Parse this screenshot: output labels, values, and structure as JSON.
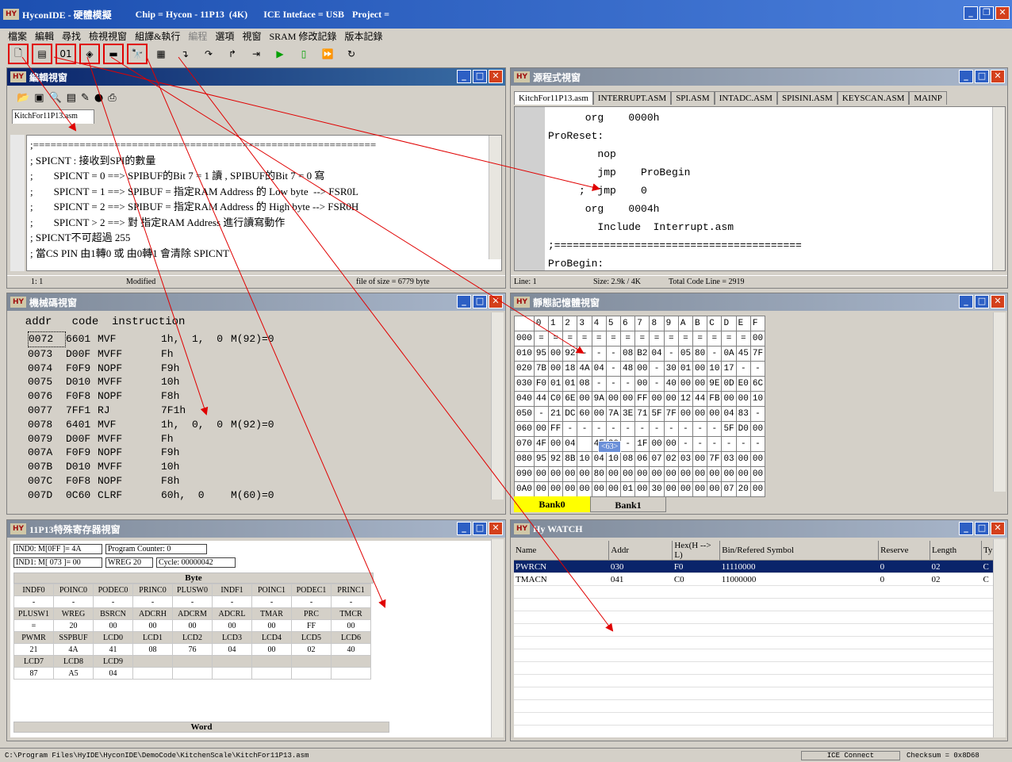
{
  "app": {
    "title": "HyconIDE - 硬體模擬",
    "chip": "Chip = Hycon - 11P13  (4K)",
    "ice": "ICE Inteface = USB",
    "project": "Project ="
  },
  "menu": [
    "檔案",
    "編輯",
    "尋找",
    "檢視視窗",
    "組譯&執行",
    "編程",
    "選項",
    "視窗",
    "SRAM 修改記錄",
    "版本記錄"
  ],
  "toolbar": [
    "new-file-icon",
    "open-file-icon",
    "binary-icon",
    "chip-icon",
    "link-icon",
    "find-icon",
    "memory-icon",
    "step-into-icon",
    "step-over-icon",
    "step-out-icon",
    "run-to-cursor-icon",
    "run-icon",
    "stop-icon",
    "fast-run-icon",
    "reset-icon"
  ],
  "editor": {
    "title": "編輯視窗",
    "tab": "KitchFor11P13.asm",
    "lines": [
      ";===========================================================",
      "; SPICNT : 接收到SPI的數量",
      ";        SPICNT = 0 ==> SPIBUF的Bit 7 = 1 讀 , SPIBUF的Bit 7 = 0 寫",
      ";        SPICNT = 1 ==> SPIBUF = 指定RAM Address 的 Low byte  --> FSR0L",
      ";        SPICNT = 2 ==> SPIBUF = 指定RAM Address 的 High byte --> FSR0H",
      ";        SPICNT > 2 ==> 對 指定RAM Address 進行讀寫動作",
      "; SPICNT不可超過 255",
      "; 當CS PIN 由1轉0 或 由0轉1 會清除 SPICNT"
    ],
    "status_pos": "1: 1",
    "status_mod": "Modified",
    "status_size": "file of size = 6779 byte"
  },
  "source": {
    "title": "源程式視窗",
    "tabs": [
      "KitchFor11P13.asm",
      "INTERRUPT.ASM",
      "SPI.ASM",
      "INTADC.ASM",
      "SPISINI.ASM",
      "KEYSCAN.ASM",
      "MAINP"
    ],
    "lines": [
      "      org    0000h",
      "ProReset:",
      "        nop",
      "        jmp    ProBegin",
      "     ;  jmp    0",
      "      org    0004h",
      "        Include  Interrupt.asm",
      ";========================================",
      "ProBegin:"
    ],
    "status_line": "Line: 1",
    "status_size": "Size: 2.9k / 4K",
    "status_total": "Total Code Line = 2919"
  },
  "disasm": {
    "title": "機械碼視窗",
    "header": "  addr   code  instruction",
    "rows": [
      [
        "0072",
        "6601",
        "MVF ",
        "1h,  1,  0",
        "M(92)=0"
      ],
      [
        "0073",
        "D00F",
        "MVFF",
        "Fh",
        ""
      ],
      [
        "0074",
        "F0F9",
        "NOPF",
        "F9h",
        ""
      ],
      [
        "0075",
        "D010",
        "MVFF",
        "10h",
        ""
      ],
      [
        "0076",
        "F0F8",
        "NOPF",
        "F8h",
        ""
      ],
      [
        "0077",
        "7FF1",
        "RJ  ",
        "7F1h",
        ""
      ],
      [
        "0078",
        "6401",
        "MVF ",
        "1h,  0,  0",
        "M(92)=0"
      ],
      [
        "0079",
        "D00F",
        "MVFF",
        "Fh",
        ""
      ],
      [
        "007A",
        "F0F9",
        "NOPF",
        "F9h",
        ""
      ],
      [
        "007B",
        "D010",
        "MVFF",
        "10h",
        ""
      ],
      [
        "007C",
        "F0F8",
        "NOPF",
        "F8h",
        ""
      ],
      [
        "007D",
        "0C60",
        "CLRF",
        "60h,  0",
        "M(60)=0"
      ]
    ]
  },
  "memory": {
    "title": "靜態記憶體視窗",
    "cols": [
      "0",
      "1",
      "2",
      "3",
      "4",
      "5",
      "6",
      "7",
      "8",
      "9",
      "A",
      "B",
      "C",
      "D",
      "E",
      "F"
    ],
    "rows": [
      [
        "000",
        "=",
        "=",
        "=",
        "=",
        "=",
        "=",
        "=",
        "=",
        "=",
        "=",
        "=",
        "=",
        "=",
        "=",
        "=",
        "00"
      ],
      [
        "010",
        "95",
        "00",
        "92",
        "-",
        "-",
        "-",
        "08",
        "B2",
        "04",
        "-",
        "05",
        "80",
        "-",
        "0A",
        "45",
        "7F"
      ],
      [
        "020",
        "7B",
        "00",
        "18",
        "4A",
        "04",
        "-",
        "48",
        "00",
        "-",
        "30",
        "01",
        "00",
        "10",
        "17",
        "-",
        "-"
      ],
      [
        "030",
        "F0",
        "01",
        "01",
        "08",
        "-",
        "-",
        "-",
        "00",
        "-",
        "40",
        "00",
        "00",
        "9E",
        "0D",
        "E0",
        "6C"
      ],
      [
        "040",
        "44",
        "C0",
        "6E",
        "00",
        "9A",
        "00",
        "00",
        "FF",
        "00",
        "00",
        "12",
        "44",
        "FB",
        "00",
        "00",
        "10"
      ],
      [
        "050",
        "-",
        "21",
        "DC",
        "60",
        "00",
        "7A",
        "3E",
        "71",
        "5F",
        "7F",
        "00",
        "00",
        "00",
        "04",
        "83",
        "-"
      ],
      [
        "060",
        "00",
        "FF",
        "-",
        "-",
        "-",
        "-",
        "-",
        "-",
        "-",
        "-",
        "-",
        "-",
        "-",
        "5F",
        "D0",
        "00"
      ],
      [
        "070",
        "4F",
        "00",
        "04",
        "",
        "4F",
        "20",
        "-",
        "1F",
        "00",
        "00",
        "-",
        "-",
        "-",
        "-",
        "-",
        "-"
      ],
      [
        "080",
        "95",
        "92",
        "8B",
        "10",
        "04",
        "10",
        "08",
        "06",
        "07",
        "02",
        "03",
        "00",
        "7F",
        "03",
        "00",
        "00"
      ],
      [
        "090",
        "00",
        "00",
        "00",
        "00",
        "80",
        "00",
        "00",
        "00",
        "00",
        "00",
        "00",
        "00",
        "00",
        "00",
        "00",
        "00"
      ],
      [
        "0A0",
        "00",
        "00",
        "00",
        "00",
        "00",
        "00",
        "01",
        "00",
        "30",
        "00",
        "00",
        "00",
        "00",
        "07",
        "20",
        "00"
      ]
    ],
    "tooltip": "<63>",
    "bank0": "Bank0",
    "bank1": "Bank1"
  },
  "sfr": {
    "title": "11P13特殊寄存器視窗",
    "ind0": "IND0: M[0FF ]= 4A",
    "ind1": "IND1: M[ 073 ]= 00",
    "pc": "Program Counter: 0",
    "wreg": "WREG 20",
    "cycle": "Cycle: 00000042",
    "byte_label": "Byte",
    "word_label": "Word",
    "grid": [
      [
        "INDF0",
        "POINC0",
        "PODEC0",
        "PRINC0",
        "PLUSW0",
        "INDF1",
        "POINC1",
        "PODEC1",
        "PRINC1"
      ],
      [
        "-",
        "-",
        "-",
        "-",
        "-",
        "-",
        "-",
        "-",
        "-"
      ],
      [
        "PLUSW1",
        "WREG",
        "BSRCN",
        "ADCRH",
        "ADCRM",
        "ADCRL",
        "TMAR",
        "PRC",
        "TMCR"
      ],
      [
        "=",
        "20",
        "00",
        "00",
        "00",
        "00",
        "00",
        "FF",
        "00"
      ],
      [
        "PWMR",
        "SSPBUF",
        "LCD0",
        "LCD1",
        "LCD2",
        "LCD3",
        "LCD4",
        "LCD5",
        "LCD6"
      ],
      [
        "21",
        "4A",
        "41",
        "08",
        "76",
        "04",
        "00",
        "02",
        "40"
      ],
      [
        "LCD7",
        "LCD8",
        "LCD9",
        "",
        "",
        "",
        "",
        "",
        ""
      ],
      [
        "87",
        "A5",
        "04",
        "",
        "",
        "",
        "",
        "",
        ""
      ]
    ]
  },
  "watch": {
    "title": "Hy WATCH",
    "headers": [
      "Name",
      "Addr",
      "Hex(H --> L)",
      "Bin/Refered Symbol",
      "Reserve",
      "Length",
      "Ty"
    ],
    "rows": [
      [
        "PWRCN",
        "030",
        "F0",
        "11110000",
        "0",
        "02",
        "C"
      ],
      [
        "TMACN",
        "041",
        "C0",
        "11000000",
        "0",
        "02",
        "C"
      ]
    ]
  },
  "statusbar": {
    "path": "C:\\Program Files\\HyIDE\\HyconIDE\\DemoCode\\KitchenScale\\KitchFor11P13.asm",
    "ice": "ICE Connect",
    "checksum": "Checksum = 0x8D68"
  }
}
